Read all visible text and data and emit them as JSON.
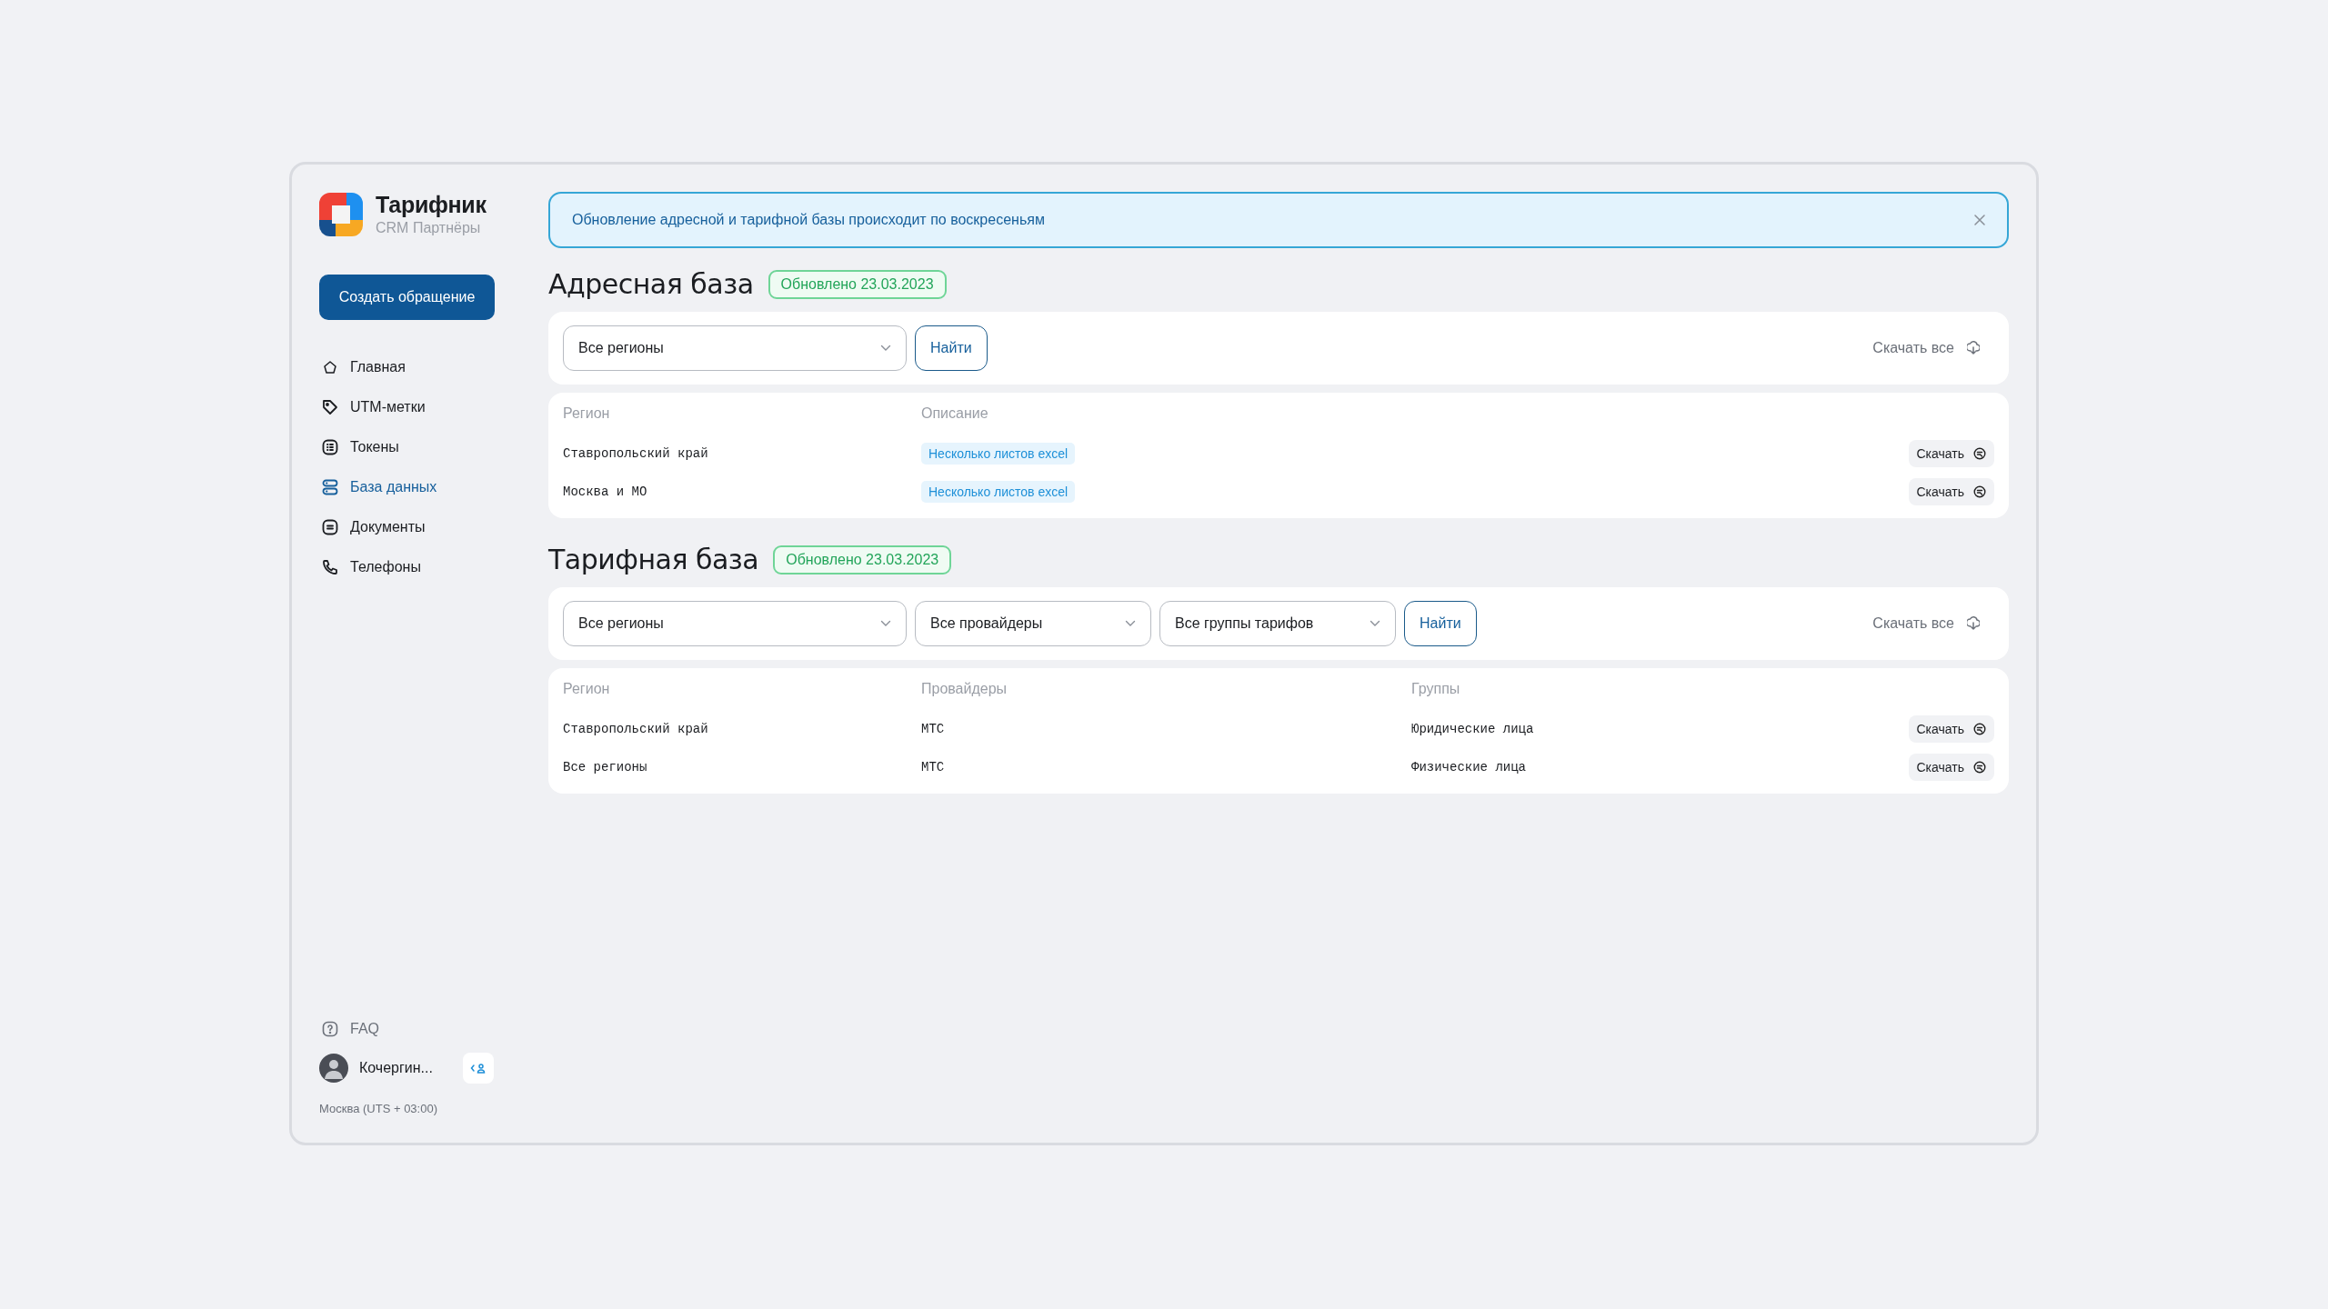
{
  "app": {
    "name": "Тарифник",
    "subtitle": "CRM Партнёры"
  },
  "sidebar": {
    "create_button": "Создать обращение",
    "items": [
      {
        "label": "Главная",
        "selected": false
      },
      {
        "label": "UTM-метки",
        "selected": false
      },
      {
        "label": "Токены",
        "selected": false
      },
      {
        "label": "База данных",
        "selected": true
      },
      {
        "label": "Документы",
        "selected": false
      },
      {
        "label": "Телефоны",
        "selected": false
      }
    ],
    "faq": "FAQ",
    "user": {
      "name": "Кочергин...",
      "timezone": "Москва (UTS + 03:00)"
    }
  },
  "banner": {
    "text": "Обновление адресной и тарифной базы происходит по воскресеньям"
  },
  "sections": [
    {
      "title": "Адресная база",
      "badge": "Обновлено 23.03.2023",
      "filters": [
        "Все регионы"
      ],
      "search_button": "Найти",
      "download_all": "Скачать все",
      "table": {
        "columns": [
          {
            "label": "Регион",
            "kind": "text"
          },
          {
            "label": "Описание",
            "kind": "tag"
          }
        ],
        "rows": [
          {
            "cells": [
              "Ставропольский край",
              "Несколько листов excel"
            ],
            "action": "Скачать"
          },
          {
            "cells": [
              "Москва и МО",
              "Несколько листов excel"
            ],
            "action": "Скачать"
          }
        ]
      }
    },
    {
      "title": "Тарифная база",
      "badge": "Обновлено 23.03.2023",
      "filters": [
        "Все регионы",
        "Все провайдеры",
        "Все группы тарифов"
      ],
      "search_button": "Найти",
      "download_all": "Скачать все",
      "table": {
        "columns": [
          {
            "label": "Регион",
            "kind": "text"
          },
          {
            "label": "Провайдеры",
            "kind": "text"
          },
          {
            "label": "Группы",
            "kind": "text"
          }
        ],
        "rows": [
          {
            "cells": [
              "Ставропольский край",
              "МТС",
              "Юридические лица"
            ],
            "action": "Скачать"
          },
          {
            "cells": [
              "Все регионы",
              "МТС",
              "Физические лица"
            ],
            "action": "Скачать"
          }
        ]
      }
    }
  ]
}
